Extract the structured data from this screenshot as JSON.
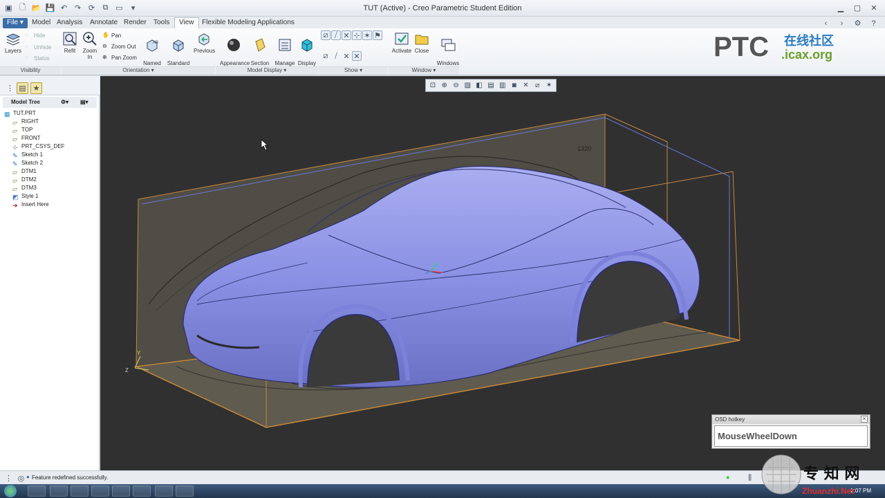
{
  "window": {
    "title": "TUT (Active) - Creo Parametric Student Edition"
  },
  "tabs": [
    {
      "label": "File ▾"
    },
    {
      "label": "Model"
    },
    {
      "label": "Analysis"
    },
    {
      "label": "Annotate"
    },
    {
      "label": "Render"
    },
    {
      "label": "Tools"
    },
    {
      "label": "View"
    },
    {
      "label": "Flexible Modeling"
    },
    {
      "label": "Applications"
    }
  ],
  "active_tab": "View",
  "ribbon": {
    "visibility": {
      "layers": "Layers",
      "hide": "Hide",
      "unhide": "Unhide",
      "status": "Status"
    },
    "orientation": {
      "refit": "Refit",
      "zoom_in": "Zoom In",
      "pan": "Pan",
      "zoom_out": "Zoom Out",
      "pan_zoom": "Pan Zoom",
      "named_views": "Named\nViews ▾",
      "standard_orientation": "Standard\nOrientation",
      "previous": "Previous"
    },
    "model_display": {
      "appearance_gallery": "Appearance\nGallery ▾",
      "section": "Section\n▾",
      "manage_views": "Manage\nViews ▾",
      "display_style": "Display\nStyle ▾"
    },
    "window": {
      "activate": "Activate",
      "close": "Close",
      "windows": "Windows\n▾"
    },
    "groups": {
      "visibility": "Visibility",
      "orientation": "Orientation ▾",
      "model_display": "Model Display ▾",
      "show": "Show ▾",
      "window": "Window ▾"
    }
  },
  "logo": {
    "brand": "PTC",
    "cn": "在线社区",
    "site": ".icax.org"
  },
  "model_tree": {
    "header": "Model Tree",
    "items": [
      {
        "label": "TUT.PRT",
        "icon": "part-icon"
      },
      {
        "label": "RIGHT",
        "icon": "datum-plane-icon"
      },
      {
        "label": "TOP",
        "icon": "datum-plane-icon"
      },
      {
        "label": "FRONT",
        "icon": "datum-plane-icon"
      },
      {
        "label": "PRT_CSYS_DEF",
        "icon": "csys-icon"
      },
      {
        "label": "Sketch 1",
        "icon": "sketch-icon"
      },
      {
        "label": "Sketch 2",
        "icon": "sketch-icon"
      },
      {
        "label": "DTM1",
        "icon": "datum-plane-icon"
      },
      {
        "label": "DTM2",
        "icon": "datum-plane-icon"
      },
      {
        "label": "DTM3",
        "icon": "datum-plane-icon"
      },
      {
        "label": "Style 1",
        "icon": "style-icon"
      },
      {
        "label": "Insert Here",
        "icon": "insert-arrow-icon"
      }
    ]
  },
  "viewport": {
    "dimension_label": "1320",
    "axis_labels": {
      "y": "Y",
      "z": "Z"
    }
  },
  "osd": {
    "title": "OSD hotkey",
    "text": "MouseWheelDown"
  },
  "status": {
    "message": "Feature redefined successfully."
  },
  "taskbar": {
    "clock": "2:07 PM"
  },
  "watermark": {
    "text": "专 知 网",
    "site": "Zhuanzhi.Net"
  },
  "colors": {
    "car": "#8c92e6",
    "background": "#303030",
    "accent": "#3b6ea8",
    "bounding_box": "#d08a3a"
  }
}
